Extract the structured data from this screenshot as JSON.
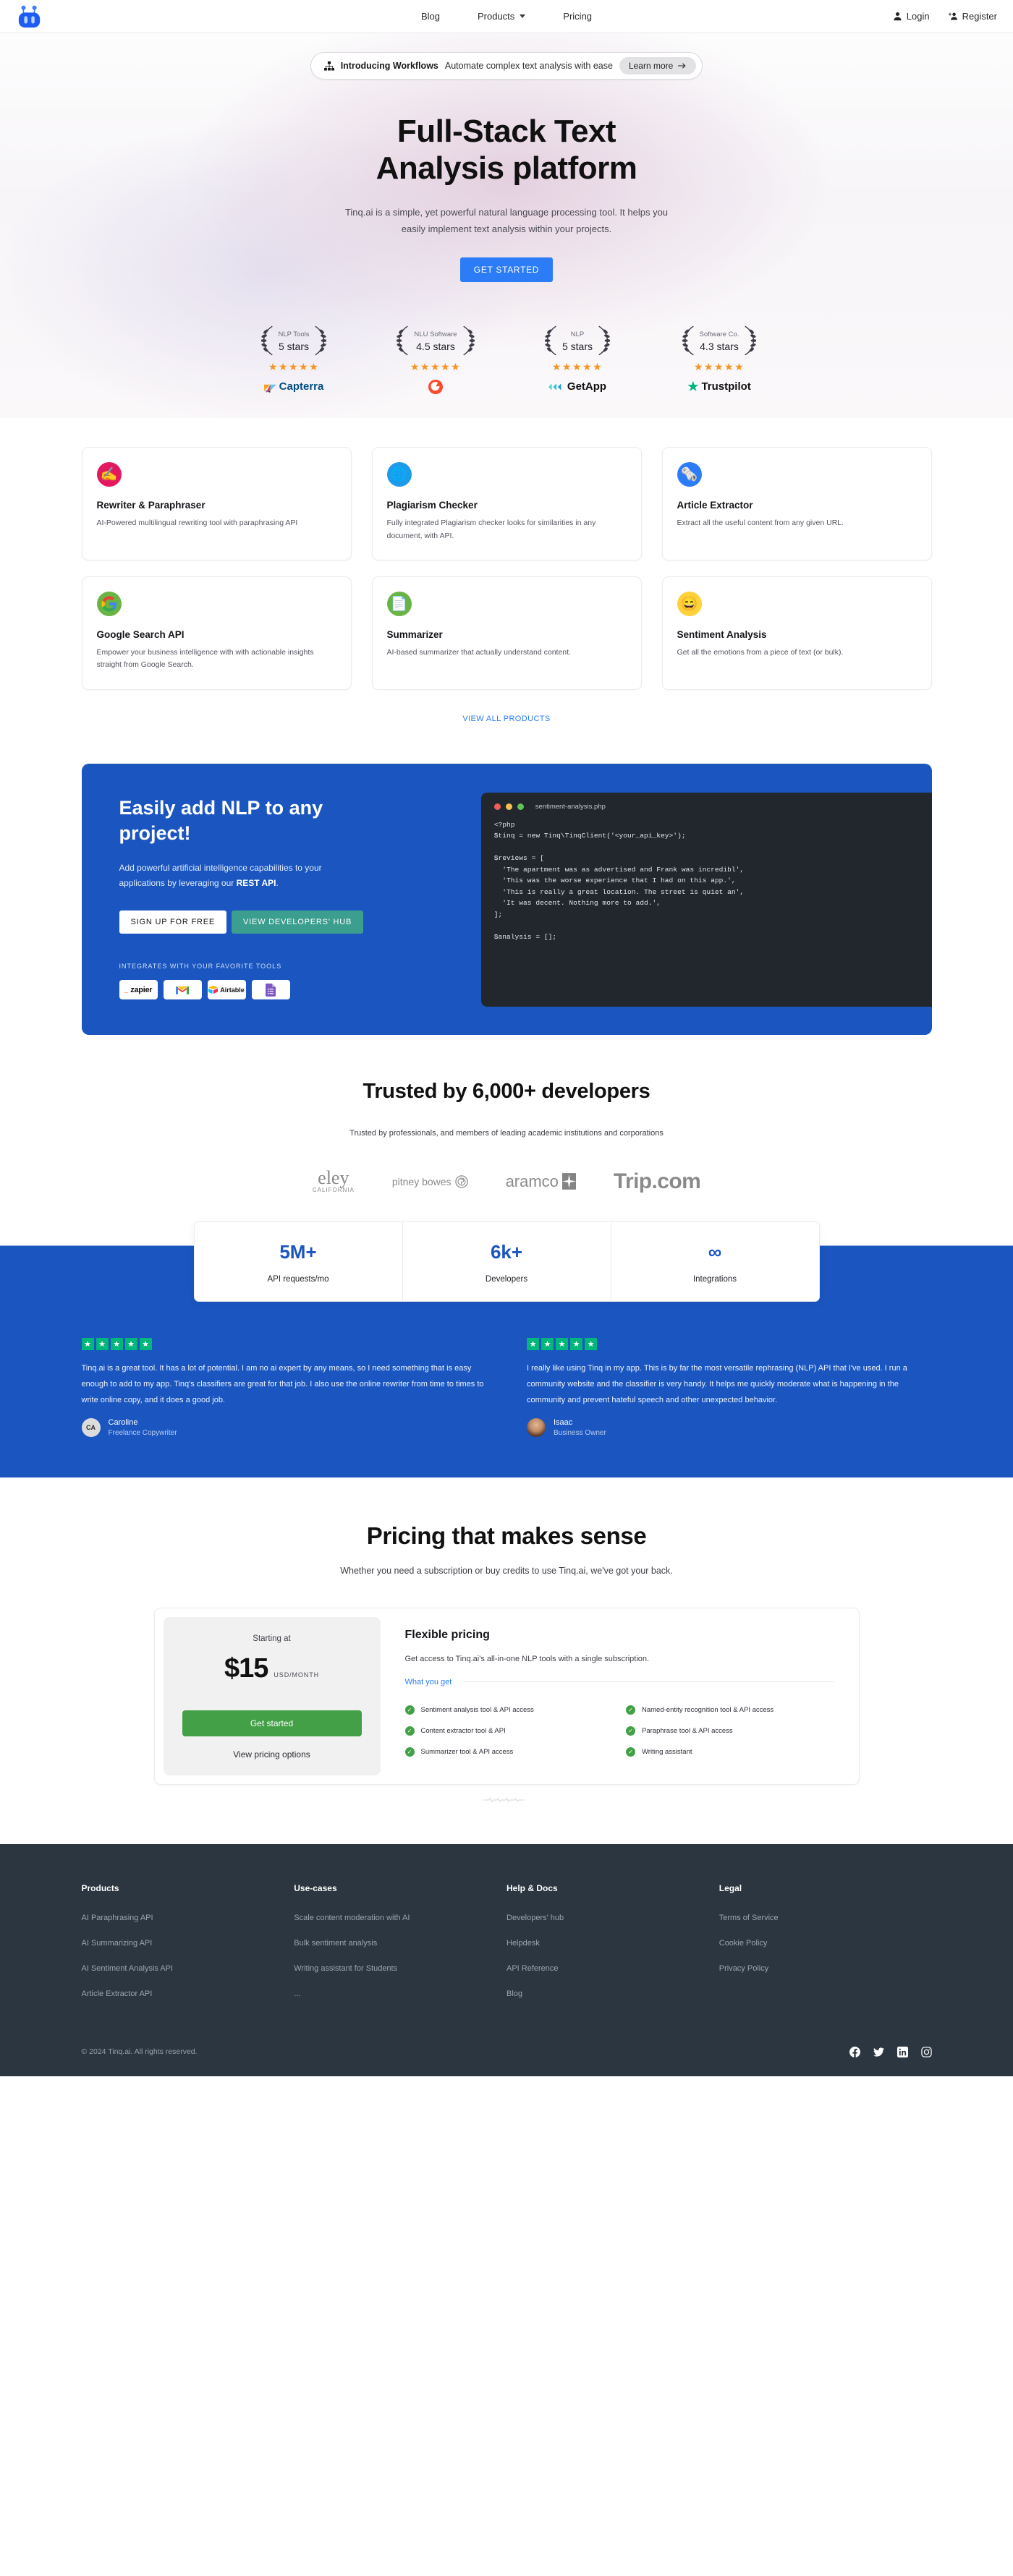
{
  "brand": {
    "name": "Tinq.ai",
    "logo_icon": "tinq-robot-logo"
  },
  "navbar": {
    "links": [
      {
        "label": "Blog",
        "icon": null
      },
      {
        "label": "Products",
        "icon": "chevron-down-icon"
      },
      {
        "label": "Pricing",
        "icon": null
      }
    ],
    "login_label": "Login",
    "login_icon": "user-icon",
    "register_label": "Register",
    "register_icon": "user-add-icon"
  },
  "announcement": {
    "icon": "org-chart-icon",
    "title": "Introducing Workflows",
    "subtitle": "Automate complex text analysis with ease",
    "cta": "Learn more",
    "cta_icon": "arrow-right-icon"
  },
  "hero": {
    "title_line1": "Full-Stack Text",
    "title_line2": "Analysis platform",
    "subtitle": "Tinq.ai is a simple, yet powerful natural language processing tool. It helps you easily implement text analysis within your projects.",
    "cta": "GET STARTED",
    "cta_color": "#2b7cf6"
  },
  "badges": [
    {
      "category": "NLP Tools",
      "rating": "5 stars",
      "stars": "★★★★★",
      "brand": "Capterra",
      "brand_icon": "capterra-logo"
    },
    {
      "category": "NLU Software",
      "rating": "4.5 stars",
      "stars": "★★★★★",
      "brand": "",
      "brand_icon": "g2-logo"
    },
    {
      "category": "NLP",
      "rating": "5 stars",
      "stars": "★★★★★",
      "brand": "GetApp",
      "brand_icon": "getapp-logo"
    },
    {
      "category": "Software Co.",
      "rating": "4.3 stars",
      "stars": "★★★★★",
      "brand": "Trustpilot",
      "brand_icon": "trustpilot-logo"
    }
  ],
  "products": {
    "cards": [
      {
        "icon": "writing-hand-emoji",
        "icon_bg": "#e4185f",
        "title": "Rewriter & Paraphraser",
        "desc": "AI-Powered multilingual rewriting tool with paraphrasing API"
      },
      {
        "icon": "globe-emoji",
        "icon_bg": "#1e9ae8",
        "title": "Plagiarism Checker",
        "desc": "Fully integrated Plagiarism checker looks for similarities in any document, with API."
      },
      {
        "icon": "newspaper-emoji",
        "icon_bg": "#2b7cf6",
        "title": "Article Extractor",
        "desc": "Extract all the useful content from any given URL."
      },
      {
        "icon": "google-logo",
        "icon_bg": "#69b444",
        "title": "Google Search API",
        "desc": "Empower your business intelligence with with actionable insights straight from Google Search."
      },
      {
        "icon": "page-facing-up-emoji",
        "icon_bg": "#69b444",
        "title": "Summarizer",
        "desc": "AI-based summarizer that actually understand content."
      },
      {
        "icon": "grinning-face-emoji",
        "icon_bg": "#ffd13b",
        "title": "Sentiment Analysis",
        "desc": "Get all the emotions from a piece of text (or bulk)."
      }
    ],
    "view_all": "VIEW ALL PRODUCTS"
  },
  "cta_section": {
    "title": "Easily add NLP to any project!",
    "desc_pre": "Add powerful artificial intelligence capabilities to your applications by leveraging our ",
    "desc_bold": "REST API",
    "desc_post": ".",
    "btn_signup": "SIGN UP FOR FREE",
    "btn_devhub": "VIEW DEVELOPERS' HUB",
    "integrates_label": "INTEGRATES WITH YOUR FAVORITE TOOLS",
    "tools": [
      {
        "name": "zapier",
        "icon": "zapier-logo"
      },
      {
        "name": "Gmail",
        "icon": "gmail-logo"
      },
      {
        "name": "Airtable",
        "icon": "airtable-logo"
      },
      {
        "name": "Google Forms",
        "icon": "google-forms-logo"
      }
    ],
    "code_window": {
      "filename": "sentiment-analysis.php",
      "dots": [
        "#ef5f56",
        "#f5bf4f",
        "#61c454"
      ],
      "code": "<?php\n$tinq = new Tinq\\TinqClient('<your_api_key>');\n\n$reviews = [\n  'The apartment was as advertised and Frank was incredibl',\n  'This was the worse experience that I had on this app.',\n  'This is really a great location. The street is quiet an',\n  'It was decent. Nothing more to add.',\n];\n\n$analysis = [];"
    }
  },
  "trusted": {
    "title": "Trusted by 6,000+ developers",
    "subtitle": "Trusted by professionals, and members of leading academic institutions and corporations",
    "logos": [
      {
        "name": "UC Berkeley",
        "label": "eley",
        "sub": "CALIFORNIA"
      },
      {
        "name": "Pitney Bowes",
        "label": "pitney bowes",
        "sub": ""
      },
      {
        "name": "Aramco",
        "label": "aramco",
        "sub": ""
      },
      {
        "name": "Trip.com",
        "label": "Trip.com",
        "sub": ""
      }
    ]
  },
  "stats": [
    {
      "value": "5M+",
      "label": "API requests/mo"
    },
    {
      "value": "6k+",
      "label": "Developers"
    },
    {
      "value": "∞",
      "label": "Integrations"
    }
  ],
  "testimonials": [
    {
      "stars": 5,
      "body": "Tinq.ai is a great tool. It has a lot of potential. I am no ai expert by any means, so I need something that is easy enough to add to my app. Tinq's classifiers are great for that job. I also use the online rewriter from time to times to write online copy, and it does a good job.",
      "name": "Caroline",
      "role": "Freelance Copywriter",
      "avatar_initials": "CA",
      "avatar_type": "initials"
    },
    {
      "stars": 5,
      "body": "I really like using Tinq in my app. This is by far the most versatile rephrasing (NLP) API that I've used. I run a community website and the classifier is very handy. It helps me quickly moderate what is happening in the community and prevent hateful speech and other unexpected behavior.",
      "name": "Isaac",
      "role": "Business Owner",
      "avatar_initials": "",
      "avatar_type": "photo"
    }
  ],
  "pricing": {
    "title": "Pricing that makes sense",
    "subtitle": "Whether you need a subscription or buy credits to use Tinq.ai, we've got your back.",
    "starting_at": "Starting at",
    "amount": "$15",
    "unit": "USD/MONTH",
    "get_started": "Get started",
    "view_options": "View pricing options",
    "plan_title": "Flexible pricing",
    "plan_desc": "Get access to Tinq.ai's all-in-one NLP tools with a single subscription.",
    "what_you_get": "What you get",
    "features": [
      "Sentiment analysis tool & API access",
      "Named-entity recognition tool & API access",
      "Content extractor tool & API",
      "Paraphrase tool & API access",
      "Summarizer tool & API access",
      "Writing assistant"
    ]
  },
  "footer": {
    "columns": [
      {
        "title": "Products",
        "links": [
          "AI Paraphrasing API",
          "AI Summarizing API",
          "AI Sentiment Analysis API",
          "Article Extractor API"
        ]
      },
      {
        "title": "Use-cases",
        "links": [
          "Scale content moderation with AI",
          "Bulk sentiment analysis",
          "Writing assistant for Students",
          "..."
        ]
      },
      {
        "title": "Help & Docs",
        "links": [
          "Developers' hub",
          "Helpdesk",
          "API Reference",
          "Blog"
        ]
      },
      {
        "title": "Legal",
        "links": [
          "Terms of Service",
          "Cookie Policy",
          "Privacy Policy"
        ]
      }
    ],
    "copyright": "© 2024 Tinq.ai. All rights reserved.",
    "socials": [
      "facebook-icon",
      "twitter-icon",
      "linkedin-icon",
      "instagram-icon"
    ]
  }
}
